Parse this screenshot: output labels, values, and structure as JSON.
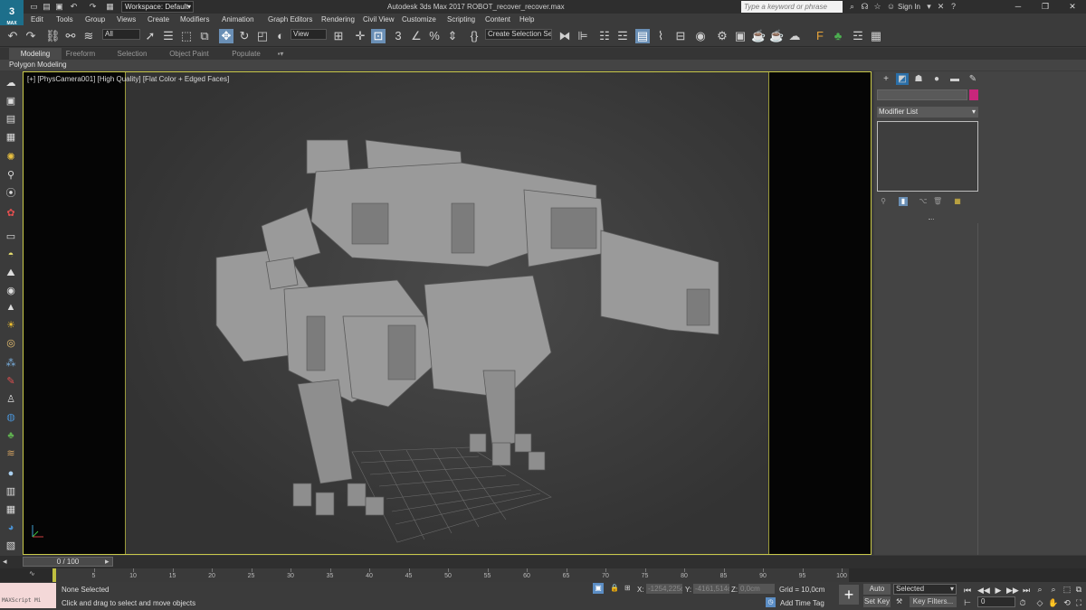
{
  "app": {
    "logo": "3",
    "logo_sub": "MAX",
    "title": "Autodesk 3ds Max 2017     ROBOT_recover_recover.max",
    "workspace": "Workspace: Default",
    "search_placeholder": "Type a keyword or phrase",
    "sign_in": "Sign In"
  },
  "menu": [
    "Edit",
    "Tools",
    "Group",
    "Views",
    "Create",
    "Modifiers",
    "Animation",
    "Graph Editors",
    "Rendering",
    "Civil View",
    "Customize",
    "Scripting",
    "Content",
    "Help"
  ],
  "toolbar": {
    "filter": "All",
    "view": "View",
    "selection_set": "Create Selection Se"
  },
  "ribbon": {
    "tabs": [
      "Modeling",
      "Freeform",
      "Selection",
      "Object Paint",
      "Populate"
    ],
    "active_tab": "Modeling",
    "panel_label": "Polygon Modeling"
  },
  "viewport": {
    "label": "[+] [PhysCamera001] [High Quality] [Flat Color + Edged Faces]"
  },
  "command_panel": {
    "modifier_list": "Modifier List",
    "object_color": "#c8267b"
  },
  "timeline": {
    "frame_display": "0 / 100",
    "ticks": [
      "5",
      "10",
      "15",
      "20",
      "25",
      "30",
      "35",
      "40",
      "45",
      "50",
      "55",
      "60",
      "65",
      "70",
      "75",
      "80",
      "85",
      "90",
      "95",
      "100"
    ]
  },
  "status": {
    "maxscript": "MAXScript Mi",
    "selection": "None Selected",
    "prompt": "Click and drag to select and move objects",
    "x_label": "X:",
    "x_value": "-1254,225c",
    "y_label": "Y:",
    "y_value": "-4161,514c",
    "z_label": "Z:",
    "z_value": "0,0cm",
    "grid": "Grid = 10,0cm",
    "add_time_tag": "Add Time Tag",
    "auto_key": "Auto Key",
    "set_key": "Set Key",
    "selected": "Selected",
    "key_filters": "Key Filters...",
    "frame": "0"
  }
}
